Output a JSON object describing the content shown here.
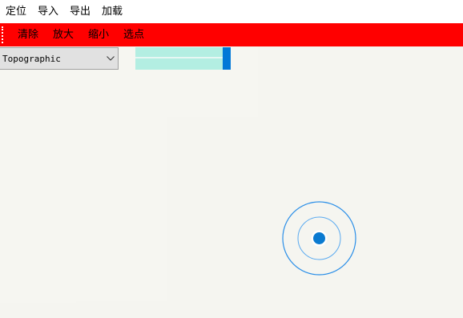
{
  "menubar": {
    "items": [
      "定位",
      "导入",
      "导出",
      "加载"
    ]
  },
  "toolbar": {
    "buttons": [
      "清除",
      "放大",
      "缩小",
      "选点"
    ],
    "background_color": "#ff0000"
  },
  "basemap_select": {
    "value": "Topographic"
  },
  "zoom_slider": {
    "level": 1.0,
    "thumb_color": "#0078d7",
    "track_color": "#b3eee2"
  },
  "location_marker": {
    "icon": "location-marker-icon",
    "color": "#0078d7"
  },
  "map": {
    "background_color": "#f5f5f0"
  }
}
